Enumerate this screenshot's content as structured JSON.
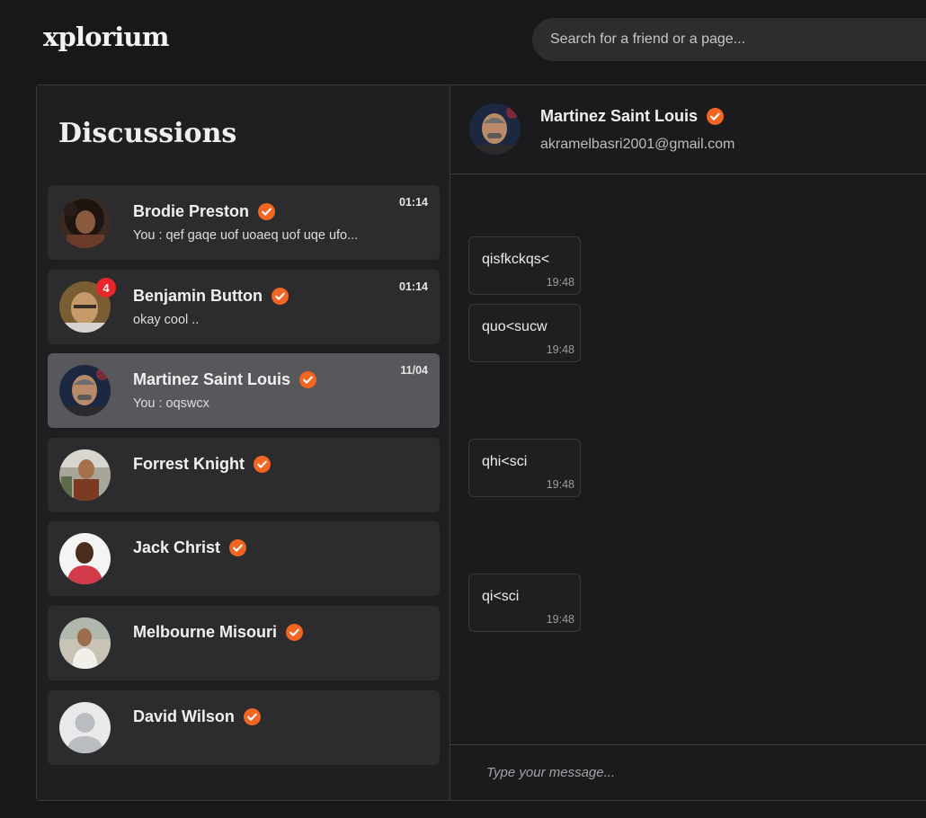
{
  "app": {
    "logo": "xplorium"
  },
  "search": {
    "placeholder": "Search for a friend or a page..."
  },
  "sidebar": {
    "title": "Discussions",
    "conversations": [
      {
        "name": "Brodie Preston",
        "preview": "You : qef gaqe uof uoaeq uof uqe ufo...",
        "time": "01:14",
        "unread": "",
        "active": false,
        "avatar": "brodie-avatar"
      },
      {
        "name": "Benjamin Button",
        "preview": "okay cool ..",
        "time": "01:14",
        "unread": "4",
        "active": false,
        "avatar": "benjamin-avatar"
      },
      {
        "name": "Martinez Saint Louis",
        "preview": "You : oqswcx",
        "time": "11/04",
        "unread": "",
        "active": true,
        "avatar": "martinez-avatar"
      },
      {
        "name": "Forrest Knight",
        "preview": "",
        "time": "",
        "unread": "",
        "active": false,
        "avatar": "forrest-avatar"
      },
      {
        "name": "Jack Christ",
        "preview": "",
        "time": "",
        "unread": "",
        "active": false,
        "avatar": "jack-avatar"
      },
      {
        "name": "Melbourne Misouri",
        "preview": "",
        "time": "",
        "unread": "",
        "active": false,
        "avatar": "melbourne-avatar"
      },
      {
        "name": "David Wilson",
        "preview": "",
        "time": "",
        "unread": "",
        "active": false,
        "avatar": "default-avatar"
      }
    ]
  },
  "chat": {
    "contact_name": "Martinez Saint Louis",
    "contact_email": "akramelbasri2001@gmail.com",
    "messages": [
      {
        "text": "qisfkckqs<",
        "time": "19:48"
      },
      {
        "text": "quo<sucw",
        "time": "19:48"
      },
      {
        "text": "qhi<sci",
        "time": "19:48"
      },
      {
        "text": "qi<sci",
        "time": "19:48"
      }
    ]
  },
  "composer": {
    "placeholder": "Type your message..."
  },
  "colors": {
    "accent": "#f26522",
    "badge": "#e8262b",
    "active_item": "#58585c",
    "item_bg": "#2c2c2f",
    "background": "#18181a"
  }
}
